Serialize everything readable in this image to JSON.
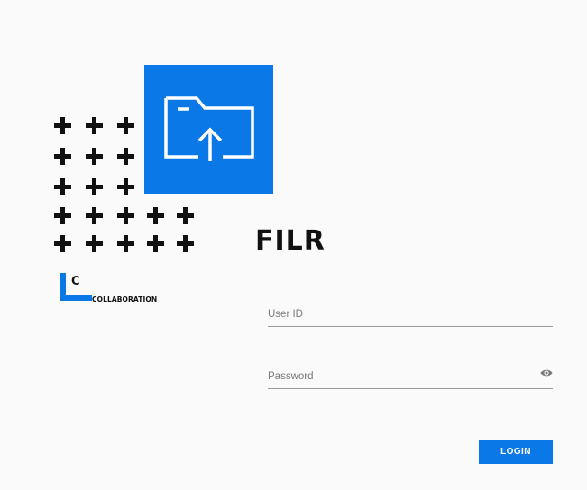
{
  "brand": {
    "app_title": "FILR",
    "collab_letter": "C",
    "collab_label": "COLLABORATION",
    "logo_icon": "folder-upload-icon",
    "accent_color": "#0a78e6"
  },
  "login_form": {
    "user_id": {
      "placeholder": "User ID",
      "value": ""
    },
    "password": {
      "placeholder": "Password",
      "value": "",
      "toggle_icon": "eye-icon"
    },
    "login_label": "LOGIN"
  }
}
